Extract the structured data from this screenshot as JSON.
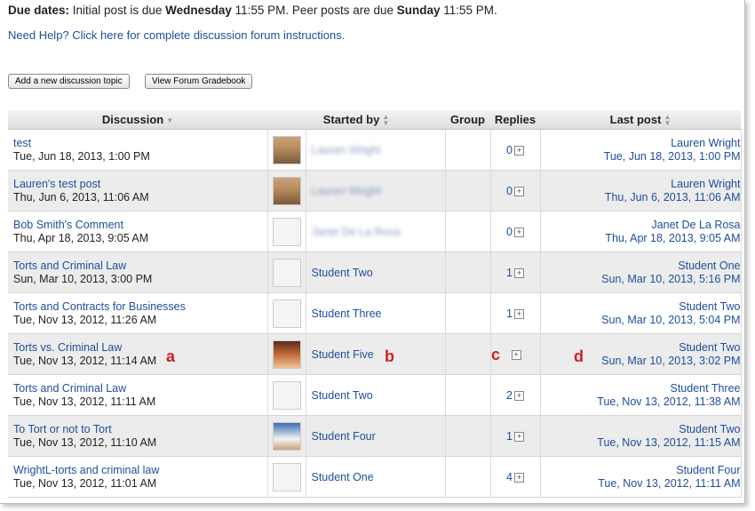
{
  "due": {
    "label": "Due dates:",
    "text1": " Initial post is due ",
    "day1": "Wednesday",
    "text2": " 11:55 PM. Peer posts are due ",
    "day2": "Sunday",
    "text3": " 11:55 PM."
  },
  "help_link": "Need Help? Click here for complete discussion forum instructions.",
  "buttons": {
    "add": "Add a new discussion topic",
    "gradebook": "View Forum Gradebook"
  },
  "columns": {
    "discussion": "Discussion",
    "started_by": "Started by",
    "group": "Group",
    "replies": "Replies",
    "last_post": "Last post"
  },
  "rows": [
    {
      "title": "test",
      "date": "Tue, Jun 18, 2013, 1:00 PM",
      "avatar": "photo1",
      "starter": "Lauren Wright",
      "starter_blurred": true,
      "replies": "0",
      "last_author": "Lauren Wright",
      "last_date": "Tue, Jun 18, 2013, 1:00 PM"
    },
    {
      "title": "Lauren's test post",
      "date": "Thu, Jun 6, 2013, 11:06 AM",
      "avatar": "photo1",
      "starter": "Lauren Wright",
      "starter_blurred": true,
      "replies": "0",
      "last_author": "Lauren Wright",
      "last_date": "Thu, Jun 6, 2013, 11:06 AM"
    },
    {
      "title": "Bob Smith's Comment",
      "date": "Thu, Apr 18, 2013, 9:05 AM",
      "avatar": "default",
      "starter": "Janet De La Rosa",
      "starter_blurred": true,
      "replies": "0",
      "last_author": "Janet De La Rosa",
      "last_date": "Thu, Apr 18, 2013, 9:05 AM"
    },
    {
      "title": "Torts and Criminal Law",
      "date": "Sun, Mar 10, 2013, 3:00 PM",
      "avatar": "default",
      "starter": "Student Two",
      "starter_blurred": false,
      "replies": "1",
      "last_author": "Student One",
      "last_date": "Sun, Mar 10, 2013, 5:16 PM"
    },
    {
      "title": "Torts and Contracts for Businesses",
      "date": "Tue, Nov 13, 2012, 11:26 AM",
      "avatar": "default",
      "starter": "Student Three",
      "starter_blurred": false,
      "replies": "1",
      "last_author": "Student Two",
      "last_date": "Sun, Mar 10, 2013, 5:04 PM"
    },
    {
      "title": "Torts vs. Criminal Law",
      "date": "Tue, Nov 13, 2012, 11:14 AM",
      "avatar": "photo2",
      "starter": "Student Five",
      "starter_blurred": false,
      "replies": "",
      "last_author": "Student Two",
      "last_date": "Sun, Mar 10, 2013, 3:02 PM"
    },
    {
      "title": "Torts and Criminal Law",
      "date": "Tue, Nov 13, 2012, 11:11 AM",
      "avatar": "default",
      "starter": "Student Two",
      "starter_blurred": false,
      "replies": "2",
      "last_author": "Student Three",
      "last_date": "Tue, Nov 13, 2012, 11:38 AM"
    },
    {
      "title": "To Tort or not to Tort",
      "date": "Tue, Nov 13, 2012, 11:10 AM",
      "avatar": "photo3",
      "starter": "Student Four",
      "starter_blurred": false,
      "replies": "1",
      "last_author": "Student Two",
      "last_date": "Tue, Nov 13, 2012, 11:15 AM"
    },
    {
      "title": "WrightL-torts and criminal law",
      "date": "Tue, Nov 13, 2012, 11:01 AM",
      "avatar": "default",
      "starter": "Student One",
      "starter_blurred": false,
      "replies": "4",
      "last_author": "Student Four",
      "last_date": "Tue, Nov 13, 2012, 11:11 AM"
    }
  ],
  "markers": {
    "a": "a",
    "b": "b",
    "c": "c",
    "d": "d"
  },
  "colors": {
    "link": "#1f4e9a",
    "marker": "#d02020",
    "row_alt": "#ececec",
    "header_bg": "#e6e6e6"
  }
}
